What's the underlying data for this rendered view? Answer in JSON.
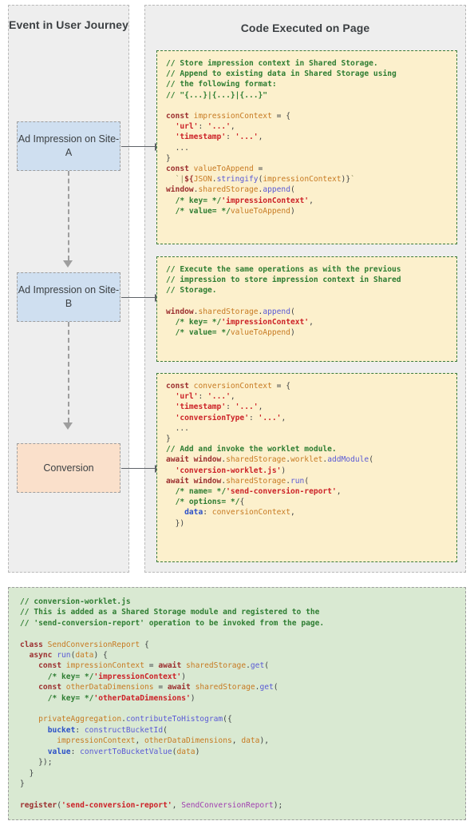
{
  "panels": {
    "left": {
      "title": "Event in User Journey"
    },
    "right": {
      "title": "Code Executed on Page"
    }
  },
  "nodes": [
    {
      "id": "node-1",
      "label": "Ad Impression on Site-A",
      "fill": "#cfdff0"
    },
    {
      "id": "node-2",
      "label": "Ad Impression on Site-B",
      "fill": "#cfdff0"
    },
    {
      "id": "node-3",
      "label": "Conversion",
      "fill": "#fae0cb"
    }
  ],
  "code_blocks": [
    {
      "id": "code-1",
      "background": "#fcf0cc",
      "border_color": "#3a7a3a",
      "lines": [
        "// Store impression context in Shared Storage.",
        "// Append to existing data in Shared Storage using",
        "// the following format:",
        "// \"{...}|{...}|{...}\"",
        "",
        "const impressionContext = {",
        "  'url': '...',",
        "  'timestamp': '...',",
        "  ...",
        "}",
        "const valueToAppend =",
        "  `|${JSON.stringify(impressionContext)}`",
        "window.sharedStorage.append(",
        "  /* key= */'impressionContext',",
        "  /* value= */valueToAppend)"
      ]
    },
    {
      "id": "code-2",
      "background": "#fcf0cc",
      "border_color": "#3a7a3a",
      "lines": [
        "// Execute the same operations as with the previous",
        "// impression to store impression context in Shared",
        "// Storage.",
        "",
        "window.sharedStorage.append(",
        "  /* key= */'impressionContext',",
        "  /* value= */valueToAppend)"
      ]
    },
    {
      "id": "code-3",
      "background": "#fcf0cc",
      "border_color": "#3a7a3a",
      "lines": [
        "const conversionContext = {",
        "  'url': '...',",
        "  'timestamp': '...',",
        "  'conversionType': '...',",
        "  ...",
        "}",
        "// Add and invoke the worklet module.",
        "await window.sharedStorage.worklet.addModule(",
        "  'conversion-worklet.js')",
        "await window.sharedStorage.run(",
        "  /* name= */'send-conversion-report',",
        "  /* options= */{",
        "    data: conversionContext,",
        "  })"
      ]
    }
  ],
  "worklet_block": {
    "background": "#d9e9d2",
    "border_color": "#9e9e9e",
    "lines": [
      "// conversion-worklet.js",
      "// This is added as a Shared Storage module and registered to the",
      "// 'send-conversion-report' operation to be invoked from the page.",
      "",
      "class SendConversionReport {",
      "  async run(data) {",
      "    const impressionContext = await sharedStorage.get(",
      "      /* key= */'impressionContext')",
      "    const otherDataDimensions = await sharedStorage.get(",
      "      /* key= */'otherDataDimensions')",
      "",
      "    privateAggregation.contributeToHistogram({",
      "      bucket: constructBucketId(",
      "        impressionContext, otherDataDimensions, data),",
      "      value: convertToBucketValue(data)",
      "    });",
      "  }",
      "}",
      "",
      "register('send-conversion-report', SendConversionReport);"
    ]
  },
  "connectors": {
    "vertical": [
      {
        "from": "node-1",
        "to": "node-2",
        "style": "dashed",
        "color": "#9e9e9e"
      },
      {
        "from": "node-2",
        "to": "node-3",
        "style": "dashed",
        "color": "#9e9e9e"
      }
    ],
    "horizontal": [
      {
        "from": "node-1",
        "to": "code-1",
        "style": "solid",
        "color": "#5f6368"
      },
      {
        "from": "node-2",
        "to": "code-2",
        "style": "solid",
        "color": "#5f6368"
      },
      {
        "from": "node-3",
        "to": "code-3",
        "style": "solid",
        "color": "#5f6368"
      }
    ]
  }
}
